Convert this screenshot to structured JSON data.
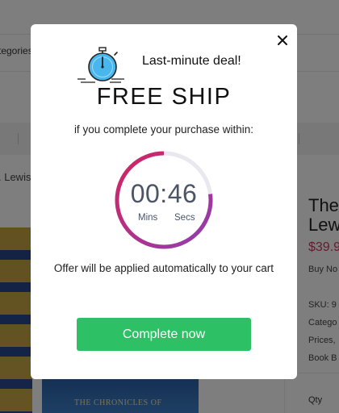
{
  "background": {
    "categories_fragment": "tegories",
    "breadcrumb_fragment": ". Lewis",
    "title_lines": [
      "The",
      "Lew"
    ],
    "price_fragment": "$39.9",
    "buy_now_fragment": "Buy No",
    "meta_lines": [
      "SKU: 9",
      "Catego",
      "Prices,",
      "Book B"
    ],
    "qty_label": "Qty",
    "cover_text": "THE CHRONICLES OF",
    "price_color": "#c8385f"
  },
  "modal": {
    "close_icon": "close-icon",
    "stopwatch_icon": "stopwatch-icon",
    "deal_label": "Last-minute deal!",
    "headline": "FREE SHIP",
    "subline": "if you complete your purchase within:",
    "timer": {
      "time": "00:46",
      "minutes_label": "Mins",
      "seconds_label": "Secs",
      "remaining_fraction": 0.77,
      "gradient_colors": [
        "#8e3fb0",
        "#d4245f"
      ],
      "track_color": "#e8e8ee"
    },
    "offer_text": "Offer will be applied automatically to your cart",
    "cta_label": "Complete now",
    "cta_color": "#2dc064"
  }
}
